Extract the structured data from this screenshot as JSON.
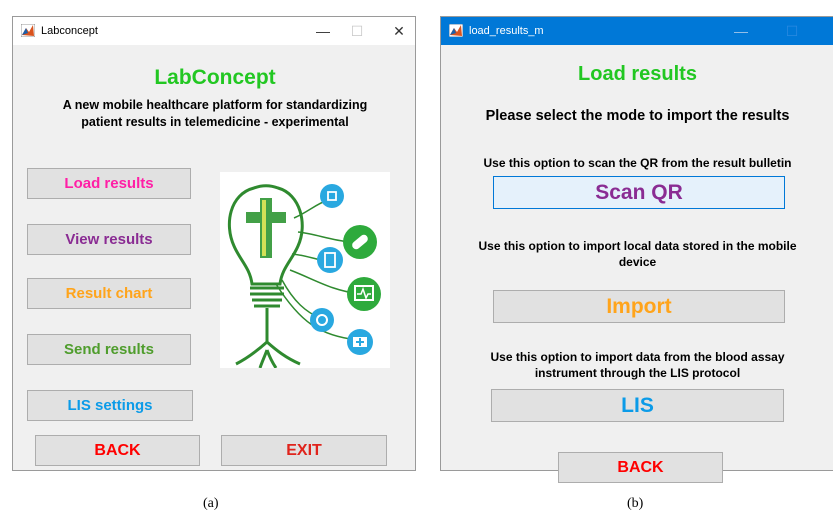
{
  "window_a": {
    "title": "Labconcept",
    "controls": {
      "minimize": "—",
      "maximize": "☐",
      "close": "✕"
    },
    "heading": "LabConcept",
    "subtitle_line1": "A new mobile healthcare platform for standardizing",
    "subtitle_line2": "patient results in telemedicine - experimental",
    "buttons": {
      "load_results": "Load results",
      "view_results": "View results",
      "result_chart": "Result chart",
      "send_results": "Send results",
      "lis_settings": "LIS settings",
      "back": "BACK",
      "exit": "EXIT"
    }
  },
  "window_b": {
    "title": "load_results_m",
    "controls": {
      "minimize": "—",
      "maximize": "☐"
    },
    "heading": "Load results",
    "prompt": "Please select the mode to import the results",
    "scan_qr_hint": "Use this option to scan the QR from the result bulletin",
    "scan_qr_label": "Scan QR",
    "import_hint_line1": "Use this option to import local data stored in the mobile",
    "import_hint_line2": "device",
    "import_label": "Import",
    "lis_hint_line1": "Use this option to import data from the blood assay",
    "lis_hint_line2": "instrument through the LIS protocol",
    "lis_label": "LIS",
    "back_label": "BACK"
  },
  "captions": {
    "a": "(a)",
    "b": "(b)"
  },
  "colors": {
    "heading_green": "#22c722",
    "load_pink": "#ff1fa6",
    "view_purple": "#8a2c93",
    "chart_orange": "#ffa41b",
    "send_green": "#4f9d2d",
    "lis_blue": "#0b9be8",
    "back_red": "#ff0000",
    "exit_red": "#e0241c",
    "titlebar_blue": "#0078d7"
  },
  "icons": [
    "matlab-logo-icon",
    "minimize-icon",
    "maximize-icon",
    "close-icon",
    "healthcare-lightbulb-illustration"
  ]
}
